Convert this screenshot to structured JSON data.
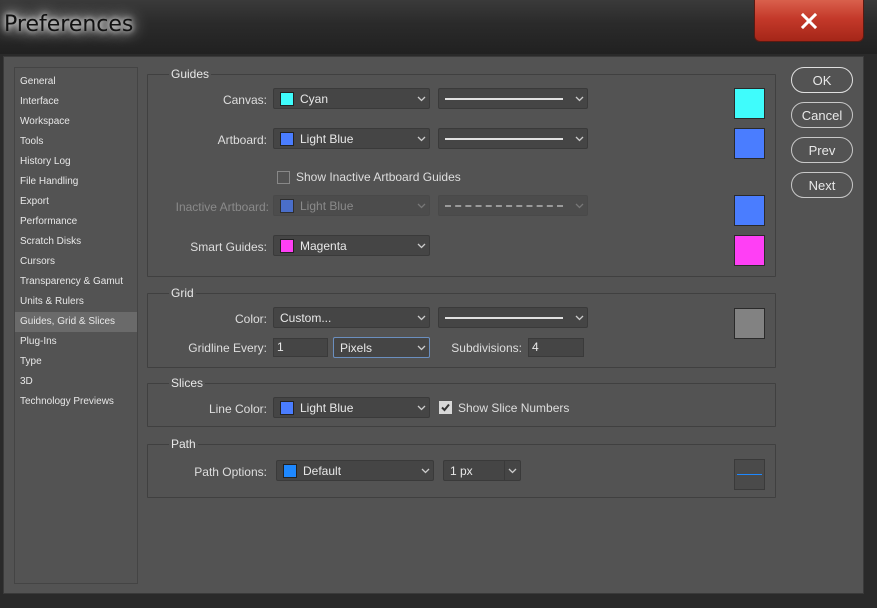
{
  "window": {
    "title": "Preferences"
  },
  "sidebar": {
    "items": [
      {
        "label": "General"
      },
      {
        "label": "Interface"
      },
      {
        "label": "Workspace"
      },
      {
        "label": "Tools"
      },
      {
        "label": "History Log"
      },
      {
        "label": "File Handling"
      },
      {
        "label": "Export"
      },
      {
        "label": "Performance"
      },
      {
        "label": "Scratch Disks"
      },
      {
        "label": "Cursors"
      },
      {
        "label": "Transparency & Gamut"
      },
      {
        "label": "Units & Rulers"
      },
      {
        "label": "Guides, Grid & Slices",
        "active": true
      },
      {
        "label": "Plug-Ins"
      },
      {
        "label": "Type"
      },
      {
        "label": "3D"
      },
      {
        "label": "Technology Previews"
      }
    ]
  },
  "guides": {
    "title": "Guides",
    "canvas": {
      "label": "Canvas:",
      "color_name": "Cyan",
      "color": "#3ffcfc"
    },
    "artboard": {
      "label": "Artboard:",
      "color_name": "Light Blue",
      "color": "#4a7dff"
    },
    "show_inactive": {
      "label": "Show Inactive Artboard Guides",
      "checked": false
    },
    "inactive_artboard": {
      "label": "Inactive Artboard:",
      "color_name": "Light Blue",
      "color": "#4a7dff"
    },
    "smart_guides": {
      "label": "Smart Guides:",
      "color_name": "Magenta",
      "color": "#ff3ff5"
    }
  },
  "grid": {
    "title": "Grid",
    "color": {
      "label": "Color:",
      "value": "Custom...",
      "swatch": "#828282"
    },
    "gridline_every": {
      "label": "Gridline Every:",
      "value": "1",
      "unit": "Pixels"
    },
    "subdivisions": {
      "label": "Subdivisions:",
      "value": "4"
    }
  },
  "slices": {
    "title": "Slices",
    "line_color": {
      "label": "Line Color:",
      "color_name": "Light Blue",
      "color": "#4a7dff"
    },
    "show_numbers": {
      "label": "Show Slice Numbers",
      "checked": true
    }
  },
  "path": {
    "title": "Path",
    "options": {
      "label": "Path Options:",
      "color_name": "Default",
      "color": "#1e88ff",
      "size": "1 px"
    }
  },
  "buttons": {
    "ok": "OK",
    "cancel": "Cancel",
    "prev": "Prev",
    "next": "Next"
  }
}
